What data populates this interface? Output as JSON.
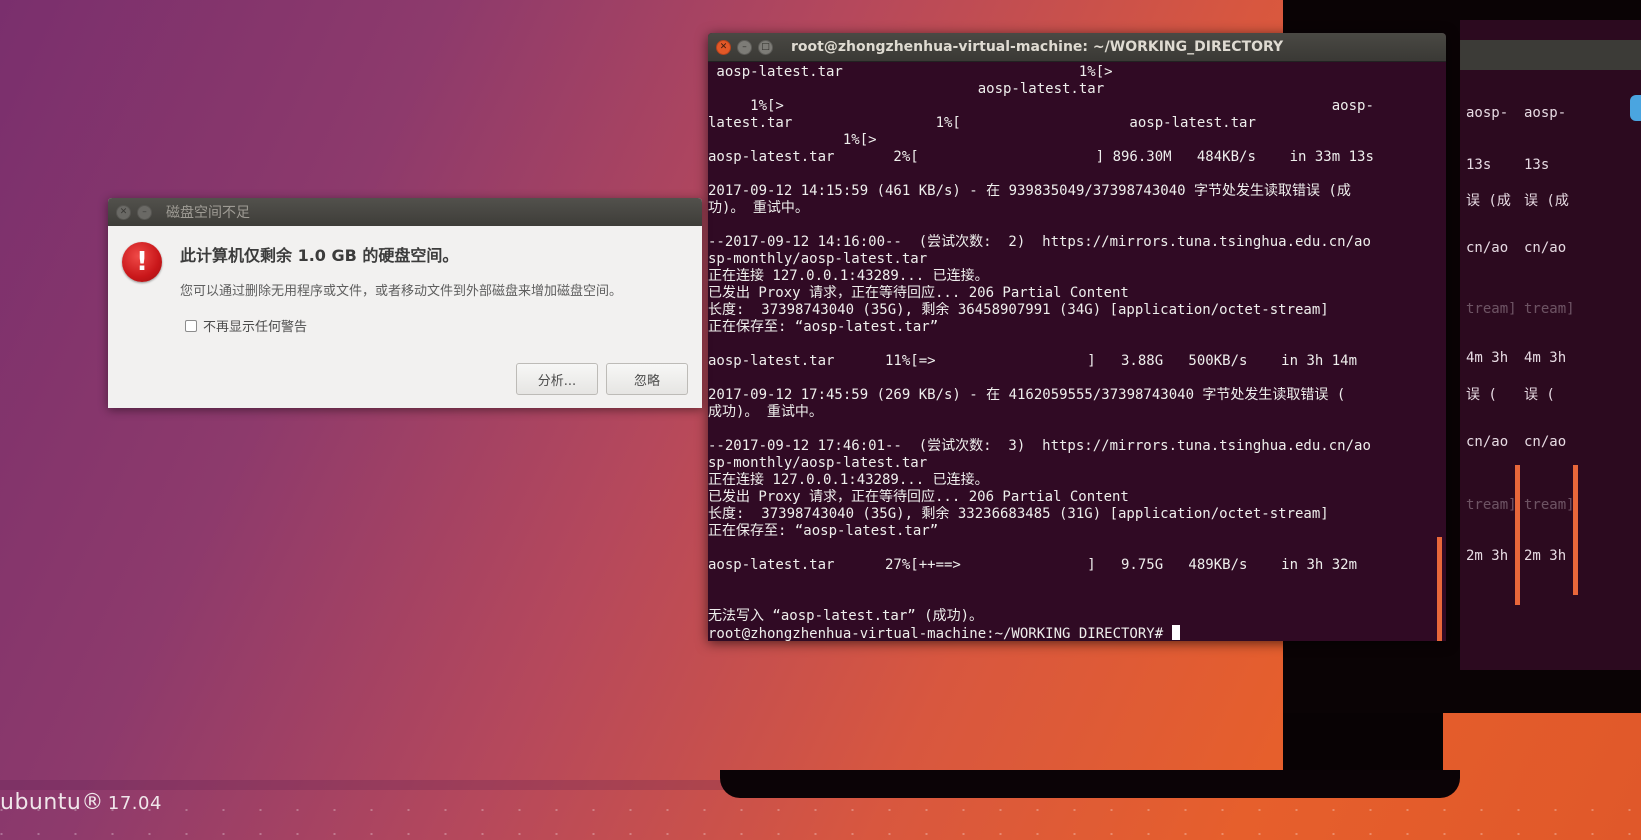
{
  "desktop": {
    "os_brand": "ubuntu",
    "os_version": "17.04",
    "accent_color": "#e95420"
  },
  "terminal": {
    "title": "root@zhongzhenhua-virtual-machine: ~/WORKING_DIRECTORY",
    "lines": [
      " aosp-latest.tar                            1%[>",
      "                                aosp-latest.tar",
      "     1%[>                                                                 aosp-",
      "latest.tar                 1%[                    aosp-latest.tar",
      "                1%[>",
      "aosp-latest.tar       2%[                     ] 896.30M   484KB/s    in 33m 13s",
      "",
      "2017-09-12 14:15:59 (461 KB/s) - 在 939835049/37398743040 字节处发生读取错误 (成",
      "功)。 重试中。",
      "",
      "--2017-09-12 14:16:00--  (尝试次数:  2)  https://mirrors.tuna.tsinghua.edu.cn/ao",
      "sp-monthly/aosp-latest.tar",
      "正在连接 127.0.0.1:43289... 已连接。",
      "已发出 Proxy 请求，正在等待回应... 206 Partial Content",
      "长度:  37398743040 (35G), 剩余 36458907991 (34G) [application/octet-stream]",
      "正在保存至: “aosp-latest.tar”",
      "",
      "aosp-latest.tar      11%[=>                  ]   3.88G   500KB/s    in 3h 14m",
      "",
      "2017-09-12 17:45:59 (269 KB/s) - 在 4162059555/37398743040 字节处发生读取错误 (",
      "成功)。 重试中。",
      "",
      "--2017-09-12 17:46:01--  (尝试次数:  3)  https://mirrors.tuna.tsinghua.edu.cn/ao",
      "sp-monthly/aosp-latest.tar",
      "正在连接 127.0.0.1:43289... 已连接。",
      "已发出 Proxy 请求，正在等待回应... 206 Partial Content",
      "长度:  37398743040 (35G), 剩余 33236683485 (31G) [application/octet-stream]",
      "正在保存至: “aosp-latest.tar”",
      "",
      "aosp-latest.tar      27%[++==>               ]   9.75G   489KB/s    in 3h 32m",
      "",
      "",
      "无法写入 “aosp-latest.tar” (成功)。"
    ],
    "prompt": "root@zhongzhenhua-virtual-machine:~/WORKING_DIRECTORY# "
  },
  "dialog": {
    "title": "磁盘空间不足",
    "heading": "此计算机仅剩余 1.0 GB 的硬盘空间。",
    "body": "您可以通过删除无用程序或文件，或者移动文件到外部磁盘来增加磁盘空间。",
    "checkbox_label": "不再显示任何警告",
    "analyze_button": "分析...",
    "ignore_button": "忽略",
    "icon": "error-icon"
  },
  "ghost_terminal": {
    "col_a": [
      "aosp-",
      "13s",
      "误 (成",
      "cn/ao",
      "tream]",
      "4m  3h",
      "误 (",
      "cn/ao",
      "tream]",
      "2m  3h"
    ],
    "col_b": [
      "aosp-",
      "13s",
      "误 (成",
      "cn/ao",
      "tream]",
      "4m  3h",
      "误 (",
      "cn/ao",
      "tream]",
      "2m  3h"
    ]
  }
}
